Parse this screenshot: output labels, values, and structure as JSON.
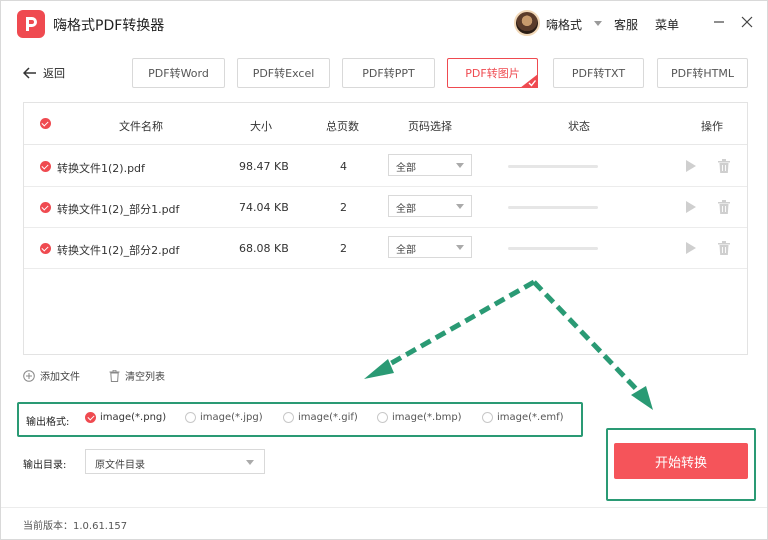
{
  "app": {
    "title": "嗨格式PDF转换器",
    "username": "嗨格式",
    "service_label": "客服",
    "menu_label": "菜单"
  },
  "colors": {
    "accent": "#ef4a50",
    "annotation": "#2a9a74"
  },
  "nav": {
    "back_label": "返回",
    "tabs": [
      {
        "label": "PDF转Word",
        "active": false
      },
      {
        "label": "PDF转Excel",
        "active": false
      },
      {
        "label": "PDF转PPT",
        "active": false
      },
      {
        "label": "PDF转图片",
        "active": true
      },
      {
        "label": "PDF转TXT",
        "active": false
      },
      {
        "label": "PDF转HTML",
        "active": false
      }
    ]
  },
  "table": {
    "headers": {
      "name": "文件名称",
      "size": "大小",
      "pages": "总页数",
      "range": "页码选择",
      "status": "状态",
      "actions": "操作"
    },
    "rows": [
      {
        "name": "转换文件1(2).pdf",
        "size": "98.47 KB",
        "pages": "4",
        "range": "全部",
        "progress": 0
      },
      {
        "name": "转换文件1(2)_部分1.pdf",
        "size": "74.04 KB",
        "pages": "2",
        "range": "全部",
        "progress": 0
      },
      {
        "name": "转换文件1(2)_部分2.pdf",
        "size": "68.08 KB",
        "pages": "2",
        "range": "全部",
        "progress": 0
      }
    ]
  },
  "actions": {
    "add_file": "添加文件",
    "clear_list": "清空列表"
  },
  "output": {
    "format_label": "输出格式:",
    "formats": [
      {
        "label": "image(*.png)",
        "selected": true
      },
      {
        "label": "image(*.jpg)",
        "selected": false
      },
      {
        "label": "image(*.gif)",
        "selected": false
      },
      {
        "label": "image(*.bmp)",
        "selected": false
      },
      {
        "label": "image(*.emf)",
        "selected": false
      }
    ],
    "dir_label": "输出目录:",
    "dir_value": "原文件目录"
  },
  "start_button": "开始转换",
  "version": "当前版本：1.0.61.157"
}
